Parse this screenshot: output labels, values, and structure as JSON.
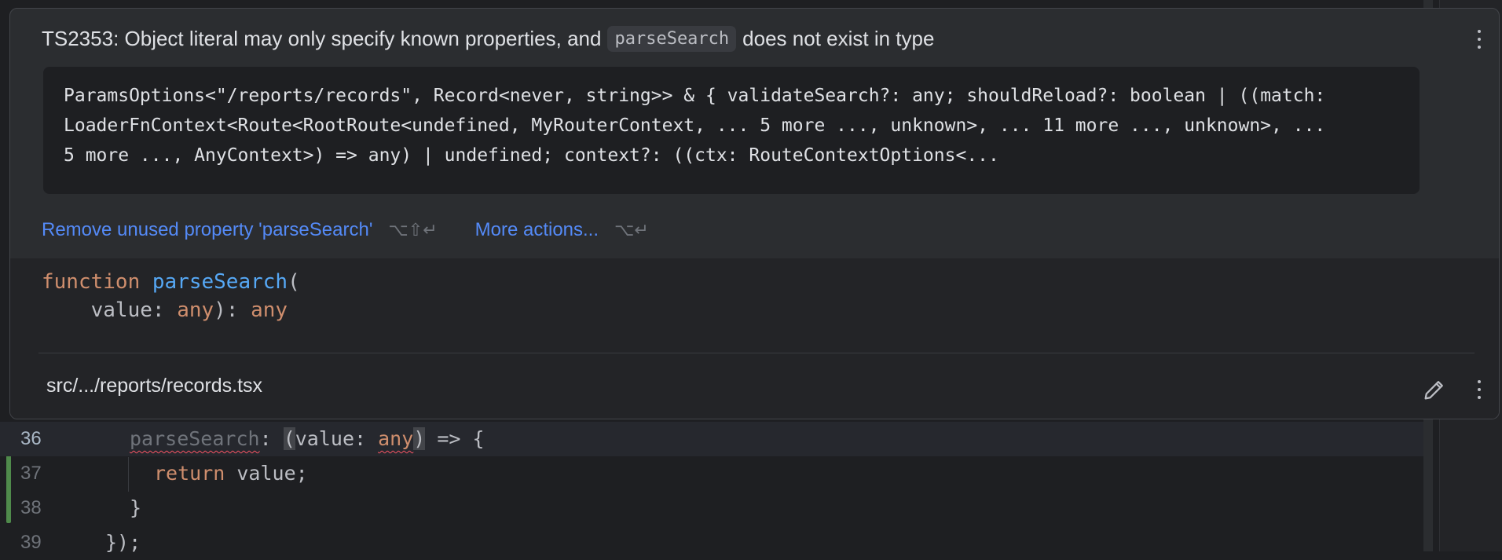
{
  "editor": {
    "lines": [
      {
        "number": "36",
        "current": true
      },
      {
        "number": "37",
        "current": false
      },
      {
        "number": "38",
        "current": false
      },
      {
        "number": "39",
        "current": false
      }
    ],
    "line36": {
      "prop": "parseSearch",
      "colon": ": ",
      "open": "(",
      "param": "value: ",
      "type": "any",
      "close": ")",
      "rest": " => {"
    },
    "line37": {
      "keyword": "return",
      "rest": " value;"
    },
    "line38": {
      "text": "}"
    },
    "line39": {
      "text": "});"
    }
  },
  "popup": {
    "title_prefix": "TS2353: Object literal may only specify known properties, and",
    "title_code": "parseSearch",
    "title_suffix": "does not exist in type",
    "type_lines": [
      "ParamsOptions<\"/reports/records\", Record<never, string>> & { validateSearch?: any; shouldReload?: boolean | ((match:",
      "LoaderFnContext<Route<RootRoute<undefined, MyRouterContext, ... 5 more ..., unknown>, ... 11 more ..., unknown>, ...",
      "5 more ..., AnyContext>) => any) | undefined; context?: ((ctx: RouteContextOptions<..."
    ],
    "actions": [
      {
        "label": "Remove unused property 'parseSearch'",
        "shortcut": "⌥⇧↵"
      },
      {
        "label": "More actions...",
        "shortcut": "⌥↵"
      }
    ],
    "signature": {
      "keyword": "function",
      "name": "parseSearch",
      "open": "(",
      "param_indent": "    value: ",
      "param_type": "any",
      "return_sep": "): ",
      "return_type": "any"
    },
    "file_path": "src/.../reports/records.tsx",
    "icons": {
      "menu": "more-vertical-icon",
      "edit": "pencil-icon"
    }
  },
  "colors": {
    "accent_link": "#548af7",
    "keyword": "#cf8e6d",
    "function": "#56a8f5",
    "vcs_modified": "#4f8a4b",
    "error": "#f75464"
  }
}
